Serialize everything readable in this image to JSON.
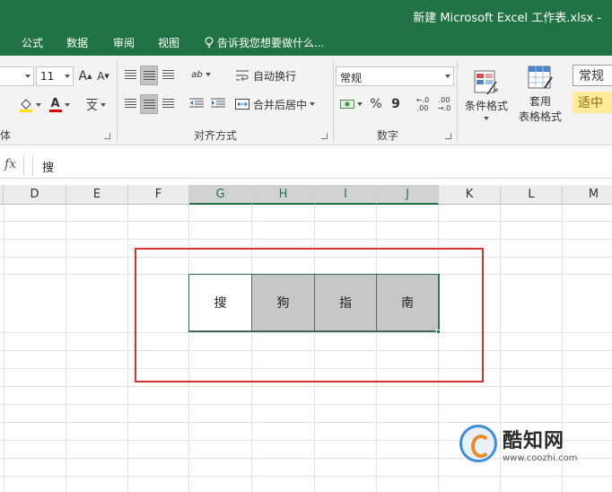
{
  "window": {
    "title": "新建 Microsoft Excel 工作表.xlsx -"
  },
  "tabs": [
    "公式",
    "数据",
    "审阅",
    "视图"
  ],
  "tell_me": "告诉我您想要做什么...",
  "ribbon": {
    "font_size": "11",
    "grow_font": "A",
    "shrink_font": "A",
    "font_color_glyph": "A",
    "phonetic_glyph": "文",
    "orientation_glyph": "ab",
    "font_group_tail": "体",
    "wrap_text": "自动换行",
    "merge_center": "合并后居中",
    "alignment_group": "对齐方式",
    "number_format": "常规",
    "percent": "%",
    "comma": "9",
    "inc_decimal": "←.0\n.00",
    "dec_decimal": ".00\n→.0",
    "number_group": "数字",
    "conditional_format": "条件格式",
    "format_as_table_1": "套用",
    "format_as_table_2": "表格格式",
    "style_normal": "常规",
    "style_neutral": "适中"
  },
  "formula_bar": {
    "fx": "fx",
    "content": "搜"
  },
  "columns": [
    "D",
    "E",
    "F",
    "G",
    "H",
    "I",
    "J",
    "K",
    "L",
    "M"
  ],
  "cells": [
    "搜",
    "狗",
    "指",
    "南"
  ],
  "watermark": {
    "name": "酷知网",
    "url": "www.coozhi.com"
  },
  "colors": {
    "excel_green": "#217346",
    "highlight_red": "#d9322e",
    "cell_gray": "#c7c7c7",
    "style_neutral_bg": "#ffeb9c"
  }
}
